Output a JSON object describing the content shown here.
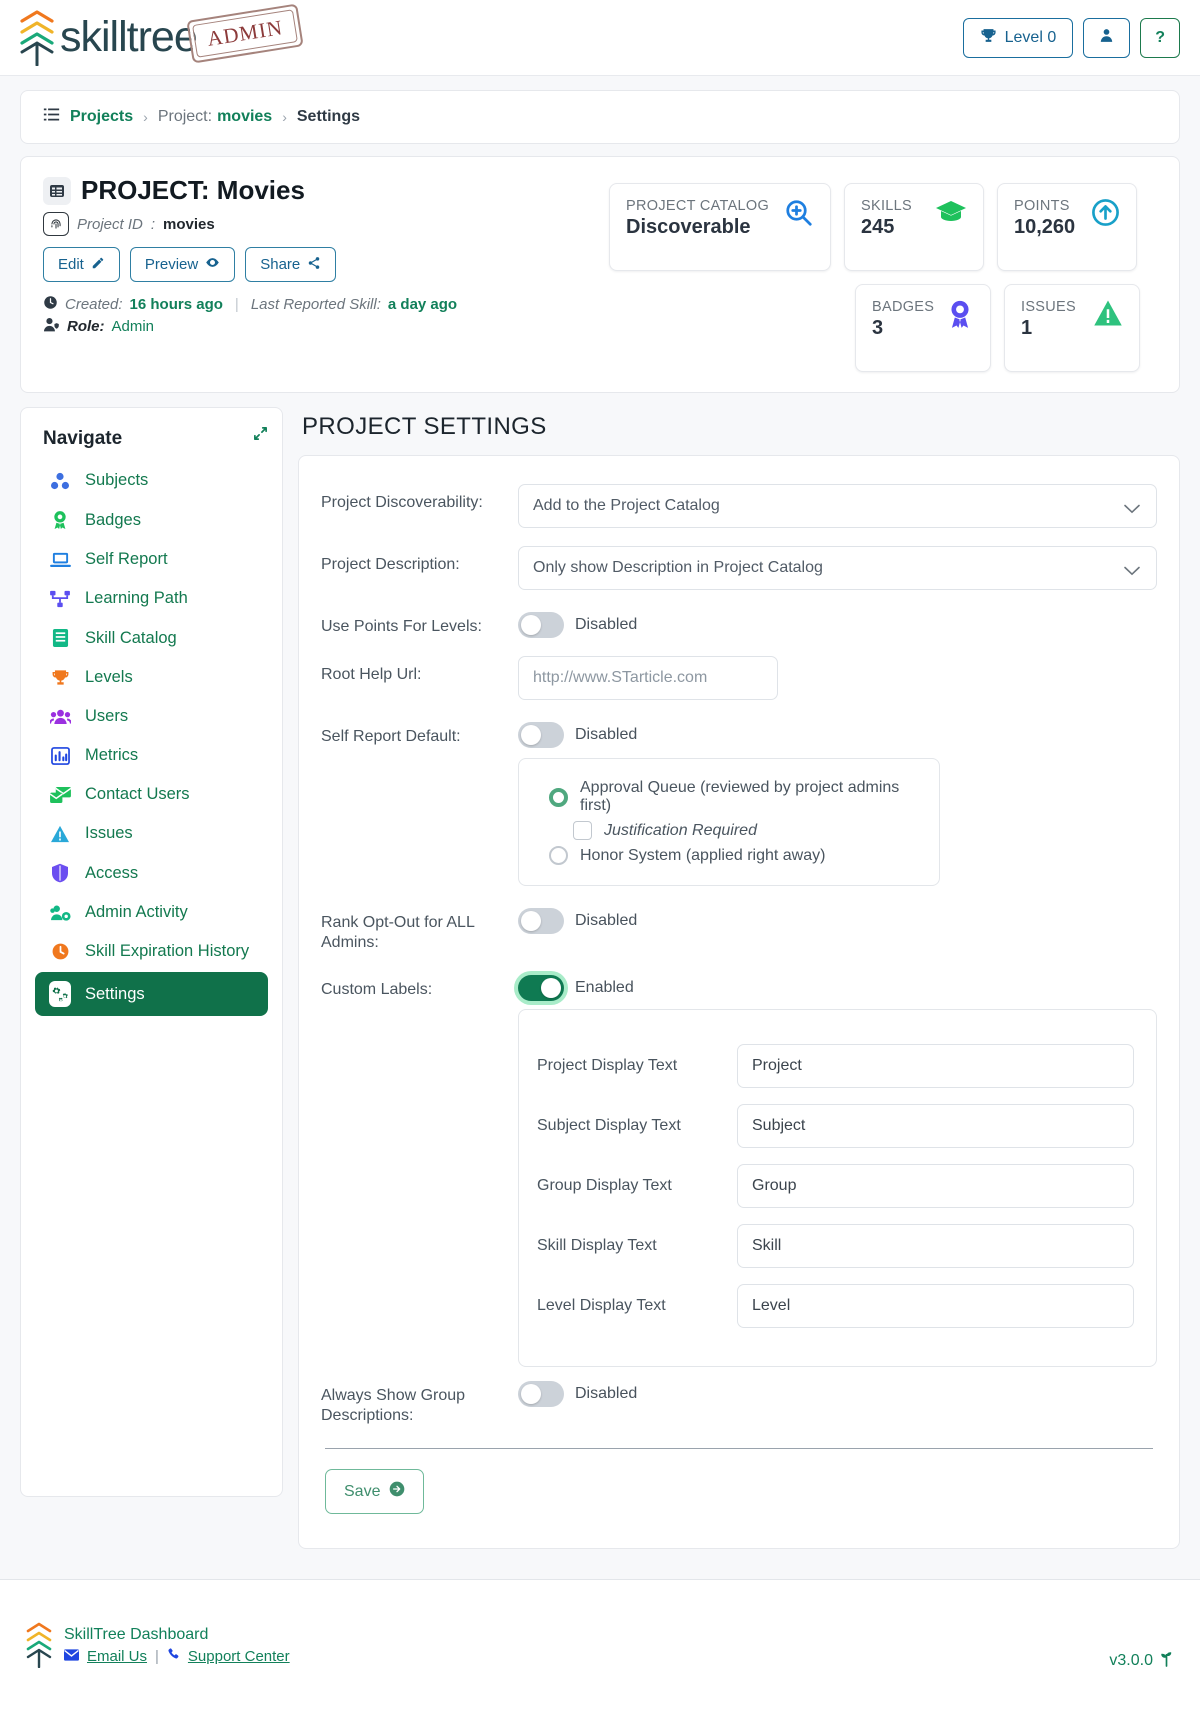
{
  "header": {
    "brand": "skilltree",
    "stamp": "ADMIN",
    "level_button": "Level 0",
    "level_icon": "trophy-icon",
    "user_icon": "user-icon",
    "help_button": "?"
  },
  "breadcrumb": {
    "icon": "list-icon",
    "root": "Projects",
    "sep": "›",
    "project_label": "Project:",
    "project_name": "movies",
    "current": "Settings"
  },
  "project": {
    "title": "PROJECT: Movies",
    "id_label": "Project ID",
    "id_value": "movies",
    "buttons": [
      {
        "label": "Edit",
        "icon": "edit-icon"
      },
      {
        "label": "Preview",
        "icon": "eye-icon"
      },
      {
        "label": "Share",
        "icon": "share-icon"
      }
    ],
    "created_label": "Created:",
    "created_value": "16 hours ago",
    "last_reported_label": "Last Reported Skill:",
    "last_reported_value": "a day ago",
    "role_label": "Role:",
    "role_value": "Admin"
  },
  "stats": [
    {
      "label": "PROJECT CATALOG",
      "value": "Discoverable",
      "icon": "magnifier-plus-icon",
      "color": "#1f7fe0"
    },
    {
      "label": "SKILLS",
      "value": "245",
      "icon": "graduation-cap-icon",
      "color": "#1ec15c"
    },
    {
      "label": "POINTS",
      "value": "10,260",
      "icon": "arrow-up-circle-icon",
      "color": "#18a0c8"
    },
    {
      "label": "BADGES",
      "value": "3",
      "icon": "award-icon",
      "color": "#5b4ef0"
    },
    {
      "label": "ISSUES",
      "value": "1",
      "icon": "warning-triangle-icon",
      "color": "#2ec27e"
    }
  ],
  "sidebar": {
    "title": "Navigate",
    "collapse_icon": "collapse-icon",
    "items": [
      {
        "label": "Subjects",
        "icon": "subjects-icon",
        "color": "#3d6fe0"
      },
      {
        "label": "Badges",
        "icon": "badge-icon",
        "color": "#1ec15c"
      },
      {
        "label": "Self Report",
        "icon": "laptop-icon",
        "color": "#1f7fe0"
      },
      {
        "label": "Learning Path",
        "icon": "learning-path-icon",
        "color": "#5b4ef0"
      },
      {
        "label": "Skill Catalog",
        "icon": "book-icon",
        "color": "#12b886"
      },
      {
        "label": "Levels",
        "icon": "trophy-icon",
        "color": "#f0781e"
      },
      {
        "label": "Users",
        "icon": "users-icon",
        "color": "#9b30e0"
      },
      {
        "label": "Metrics",
        "icon": "bar-chart-icon",
        "color": "#1f46e0"
      },
      {
        "label": "Contact Users",
        "icon": "mail-icon",
        "color": "#1ec15c"
      },
      {
        "label": "Issues",
        "icon": "warning-triangle-icon",
        "color": "#29a8d8"
      },
      {
        "label": "Access",
        "icon": "shield-icon",
        "color": "#6b4ef0"
      },
      {
        "label": "Admin Activity",
        "icon": "admin-activity-icon",
        "color": "#12b886"
      },
      {
        "label": "Skill Expiration History",
        "icon": "clock-icon",
        "color": "#f0781e"
      },
      {
        "label": "Settings",
        "icon": "gears-icon",
        "color": "#ffffff",
        "active": true
      }
    ]
  },
  "main": {
    "page_title": "PROJECT SETTINGS",
    "discoverability": {
      "label": "Project Discoverability:",
      "value": "Add to the Project Catalog"
    },
    "description": {
      "label": "Project Description:",
      "value": "Only show Description in Project Catalog"
    },
    "use_points_for_levels": {
      "label": "Use Points For Levels:",
      "state": "Disabled"
    },
    "root_help_url": {
      "label": "Root Help Url:",
      "placeholder": "http://www.STarticle.com",
      "value": ""
    },
    "self_report_default": {
      "label": "Self Report Default:",
      "state": "Disabled",
      "options": [
        {
          "label": "Approval Queue (reviewed by project admins first)",
          "selected": true
        },
        {
          "label": "Honor System (applied right away)",
          "selected": false
        }
      ],
      "justification": {
        "label": "Justification Required",
        "checked": false
      }
    },
    "rank_opt_out": {
      "label": "Rank Opt-Out for ALL Admins:",
      "state": "Disabled"
    },
    "custom_labels": {
      "label": "Custom Labels:",
      "state": "Enabled",
      "fields": [
        {
          "label": "Project Display Text",
          "value": "Project"
        },
        {
          "label": "Subject Display Text",
          "value": "Subject"
        },
        {
          "label": "Group Display Text",
          "value": "Group"
        },
        {
          "label": "Skill Display Text",
          "value": "Skill"
        },
        {
          "label": "Level Display Text",
          "value": "Level"
        }
      ]
    },
    "always_show_group_descriptions": {
      "label": "Always Show Group Descriptions:",
      "state": "Disabled"
    },
    "save_button": "Save"
  },
  "footer": {
    "title": "SkillTree Dashboard",
    "email_link": "Email Us",
    "support_link": "Support Center",
    "separator": "|",
    "version": "v3.0.0"
  }
}
